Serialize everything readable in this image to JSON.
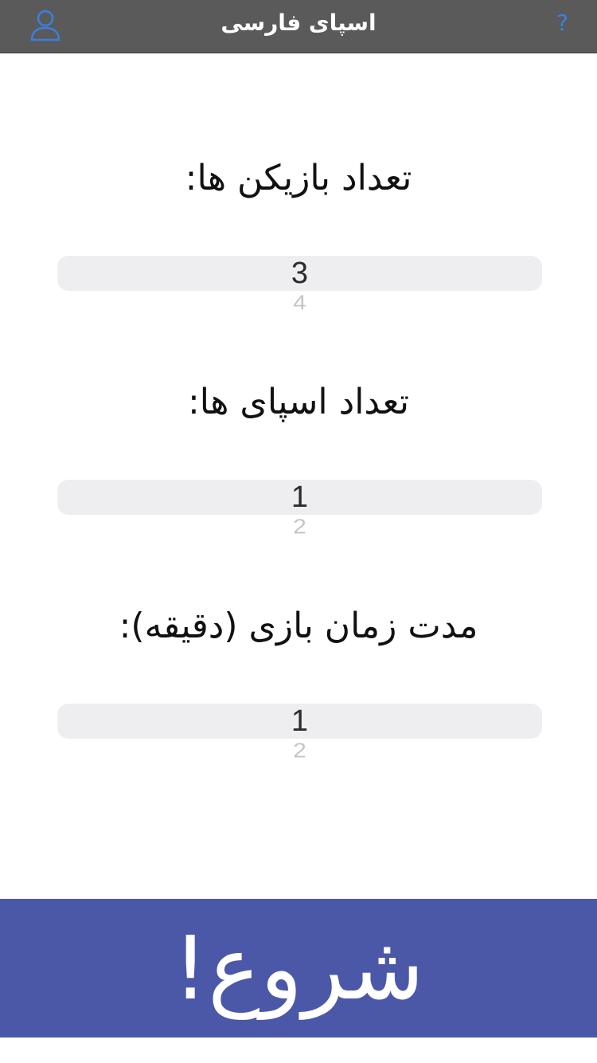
{
  "header": {
    "title": "اسپای فارسی",
    "help_label": "?",
    "profile_icon": "person-outline-icon"
  },
  "settings": {
    "players": {
      "label": "تعداد بازیکن ها:",
      "selected": "3",
      "next": "4"
    },
    "spies": {
      "label": "تعداد اسپای ها:",
      "selected": "1",
      "next": "2"
    },
    "duration": {
      "label": "مدت زمان بازی (دقیقه):",
      "selected": "1",
      "next": "2"
    }
  },
  "start_button": {
    "label": "شروع!"
  },
  "colors": {
    "navbar": "#5a5a5a",
    "accent": "#3b7fe0",
    "picker_bg": "#eeeef0",
    "start_bg": "#4b58a8"
  }
}
